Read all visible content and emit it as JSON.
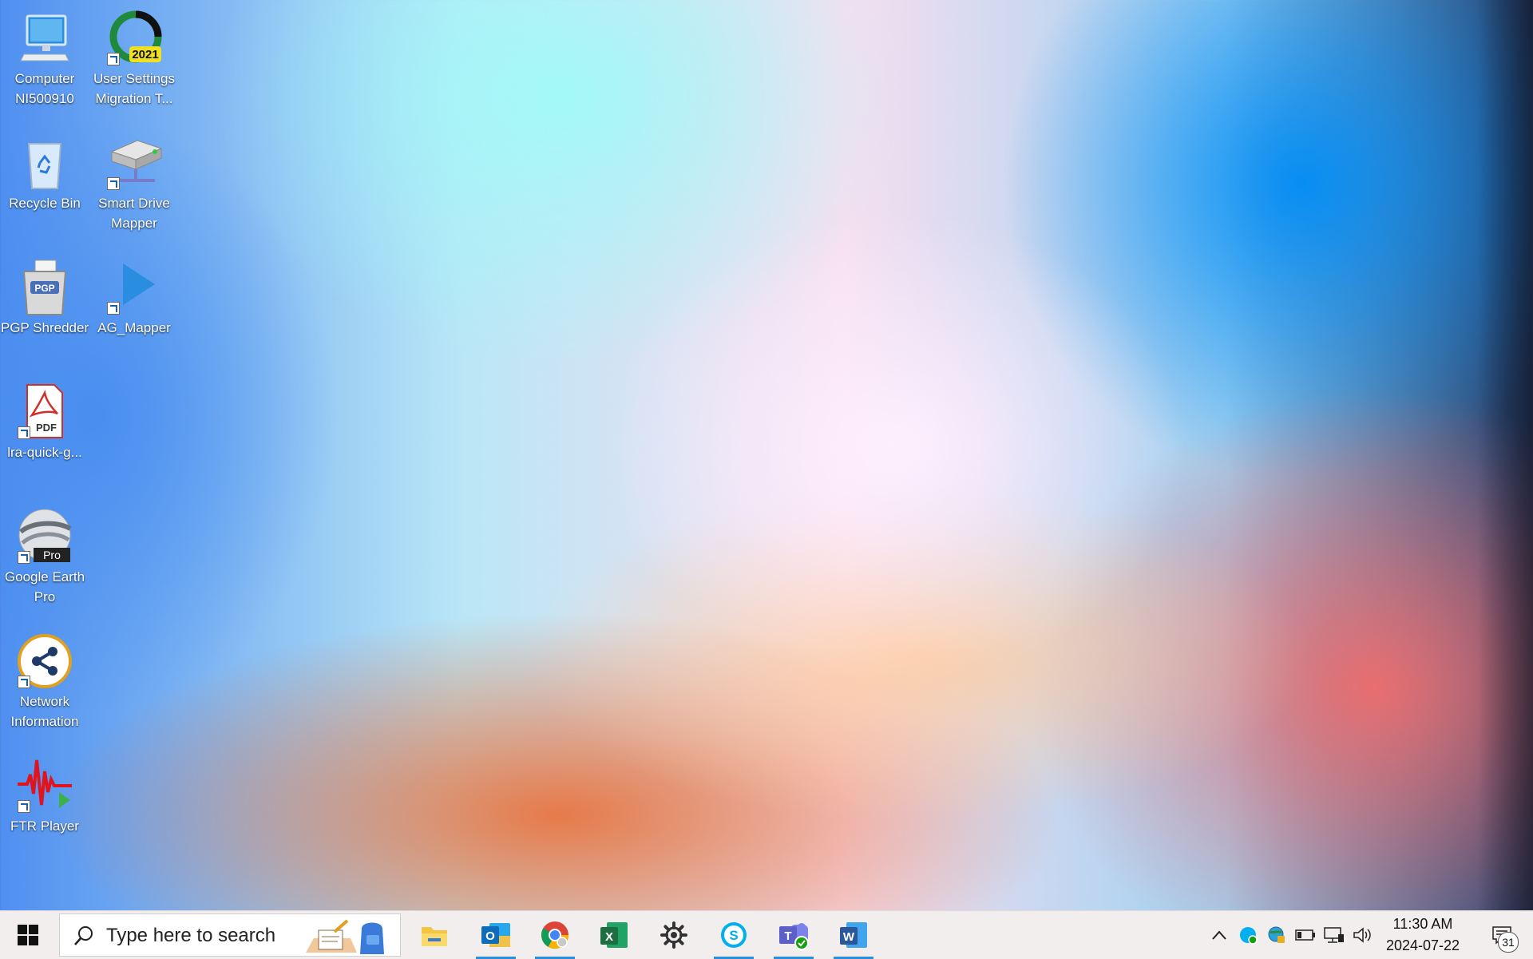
{
  "desktop": {
    "icons": [
      {
        "label": "Computer NI500910",
        "icon": "computer-icon"
      },
      {
        "label": "User Settings Migration T...",
        "icon": "migration-2021-icon",
        "badge": "2021"
      },
      {
        "label": "Recycle Bin",
        "icon": "recycle-bin-icon"
      },
      {
        "label": "Smart Drive Mapper",
        "icon": "network-drive-icon"
      },
      {
        "label": "PGP Shredder",
        "icon": "shredder-icon",
        "badge": "PGP"
      },
      {
        "label": "AG_Mapper",
        "icon": "play-arrow-icon"
      },
      {
        "label": "lra-quick-g...",
        "icon": "pdf-file-icon",
        "badge": "PDF"
      },
      {
        "label": "Google Earth Pro",
        "icon": "google-earth-icon",
        "badge": "Pro"
      },
      {
        "label": "Network Information",
        "icon": "share-network-icon"
      },
      {
        "label": "FTR Player",
        "icon": "ftr-waveform-icon"
      }
    ]
  },
  "taskbar": {
    "search_placeholder": "Type here to search",
    "pinned": [
      {
        "name": "File Explorer",
        "icon": "folder-icon",
        "active": false
      },
      {
        "name": "Outlook",
        "icon": "outlook-icon",
        "active": true,
        "letter": "O"
      },
      {
        "name": "Chrome",
        "icon": "chrome-icon",
        "active": true
      },
      {
        "name": "Excel",
        "icon": "excel-icon",
        "active": false,
        "letter": "X"
      },
      {
        "name": "Settings",
        "icon": "gear-icon",
        "active": false
      },
      {
        "name": "Skype",
        "icon": "skype-icon",
        "active": true,
        "letter": "S"
      },
      {
        "name": "Teams",
        "icon": "teams-icon",
        "active": true,
        "letter": "T"
      },
      {
        "name": "Word",
        "icon": "word-icon",
        "active": true,
        "letter": "W"
      }
    ],
    "clock": {
      "time": "11:30 AM",
      "date": "2024-07-22"
    },
    "notification_count": "31"
  },
  "colors": {
    "taskbar_bg": "#f3eeee",
    "active_indicator": "#2b8ed8",
    "excel": "#1d6f42",
    "word": "#2b579a",
    "outlook": "#0f6cbd",
    "teams": "#5b5fc7",
    "skype": "#00aff0"
  }
}
